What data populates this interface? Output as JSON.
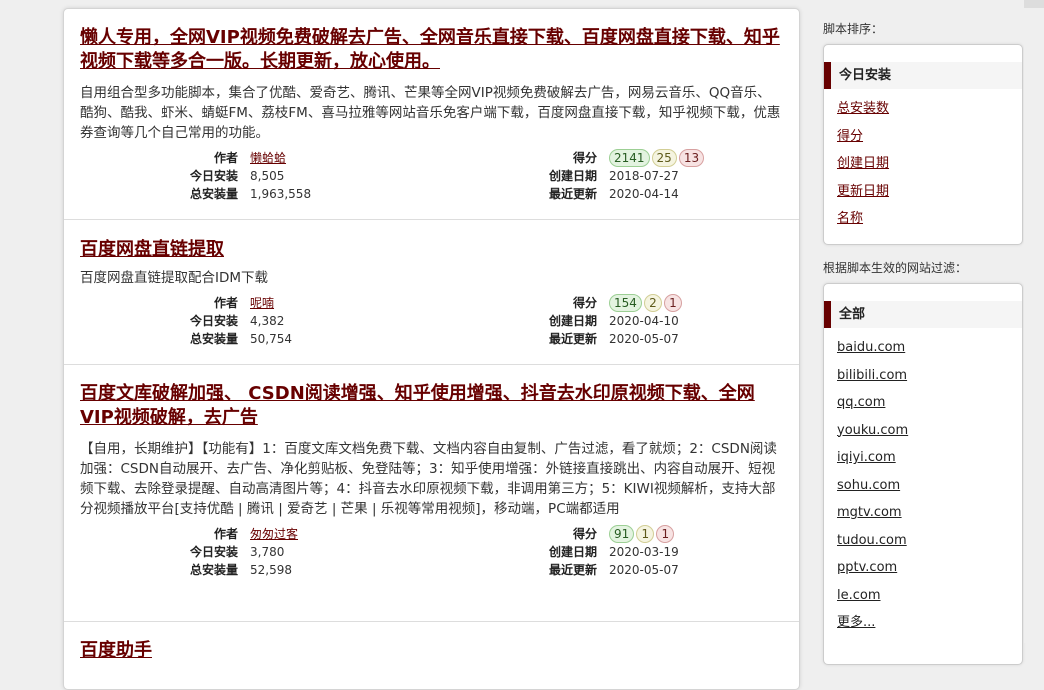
{
  "scripts": [
    {
      "title": "懒人专用，全网VIP视频免费破解去广告、全网音乐直接下载、百度网盘直接下载、知乎视频下载等多合一版。长期更新，放心使用。",
      "description": "自用组合型多功能脚本，集合了优酷、爱奇艺、腾讯、芒果等全网VIP视频免费破解去广告，网易云音乐、QQ音乐、酷狗、酷我、虾米、蜻蜓FM、荔枝FM、喜马拉雅等网站音乐免客户端下载，百度网盘直接下载，知乎视频下载，优惠券查询等几个自己常用的功能。",
      "author_label": "作者",
      "author": "懒蛤蛤",
      "daily_label": "今日安装",
      "daily": "8,505",
      "total_label": "总安装量",
      "total": "1,963,558",
      "score_label": "得分",
      "good": "2141",
      "ok": "25",
      "bad": "13",
      "created_label": "创建日期",
      "created": "2018-07-27",
      "updated_label": "最近更新",
      "updated": "2020-04-14"
    },
    {
      "title": "百度网盘直链提取",
      "description": "百度网盘直链提取配合IDM下载",
      "author_label": "作者",
      "author": "呢喃",
      "daily_label": "今日安装",
      "daily": "4,382",
      "total_label": "总安装量",
      "total": "50,754",
      "score_label": "得分",
      "good": "154",
      "ok": "2",
      "bad": "1",
      "created_label": "创建日期",
      "created": "2020-04-10",
      "updated_label": "最近更新",
      "updated": "2020-05-07"
    },
    {
      "title": "百度文库破解加强、 CSDN阅读增强、知乎使用增强、抖音去水印原视频下载、全网VIP视频破解，去广告",
      "description": "【自用，长期维护】【功能有】1：百度文库文档免费下载、文档内容自由复制、广告过滤，看了就烦；2：CSDN阅读加强：CSDN自动展开、去广告、净化剪贴板、免登陆等；3：知乎使用增强：外链接直接跳出、内容自动展开、短视频下载、去除登录提醒、自动高清图片等；4：抖音去水印原视频下载，非调用第三方；5：KIWI视频解析，支持大部分视频播放平台[支持优酷 | 腾讯 | 爱奇艺 | 芒果 | 乐视等常用视频]，移动端，PC端都适用",
      "author_label": "作者",
      "author": "匆匆过客",
      "daily_label": "今日安装",
      "daily": "3,780",
      "total_label": "总安装量",
      "total": "52,598",
      "score_label": "得分",
      "good": "91",
      "ok": "1",
      "bad": "1",
      "created_label": "创建日期",
      "created": "2020-03-19",
      "updated_label": "最近更新",
      "updated": "2020-05-07"
    },
    {
      "title": "百度助手"
    }
  ],
  "sidebar": {
    "sort_label": "脚本排序：",
    "sort_current": "今日安装",
    "sort_options": [
      "总安装数",
      "得分",
      "创建日期",
      "更新日期",
      "名称"
    ],
    "filter_label": "根据脚本生效的网站过滤：",
    "filter_current": "全部",
    "sites": [
      "baidu.com",
      "bilibili.com",
      "qq.com",
      "youku.com",
      "iqiyi.com",
      "sohu.com",
      "mgtv.com",
      "tudou.com",
      "pptv.com",
      "le.com",
      "更多..."
    ]
  }
}
